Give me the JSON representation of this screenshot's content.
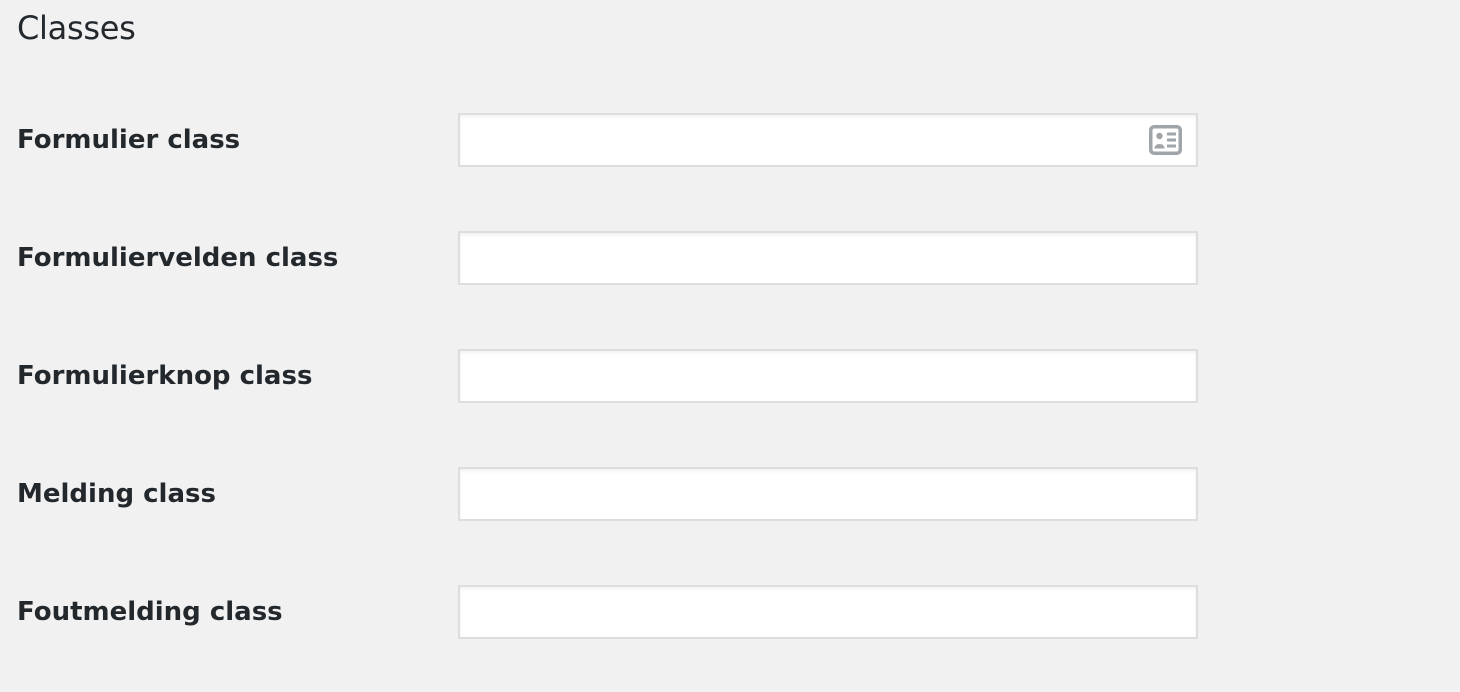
{
  "section": {
    "title": "Classes"
  },
  "fields": [
    {
      "label": "Formulier class",
      "value": "",
      "placeholder": "",
      "icon": "contact-card-icon"
    },
    {
      "label": "Formuliervelden class",
      "value": "",
      "placeholder": ""
    },
    {
      "label": "Formulierknop class",
      "value": "",
      "placeholder": ""
    },
    {
      "label": "Melding class",
      "value": "",
      "placeholder": ""
    },
    {
      "label": "Foutmelding class",
      "value": "",
      "placeholder": ""
    }
  ],
  "colors": {
    "background": "#f1f1f1",
    "text": "#23282d",
    "input_border": "#dddddd",
    "input_background": "#ffffff",
    "icon": "#a0a5aa"
  }
}
